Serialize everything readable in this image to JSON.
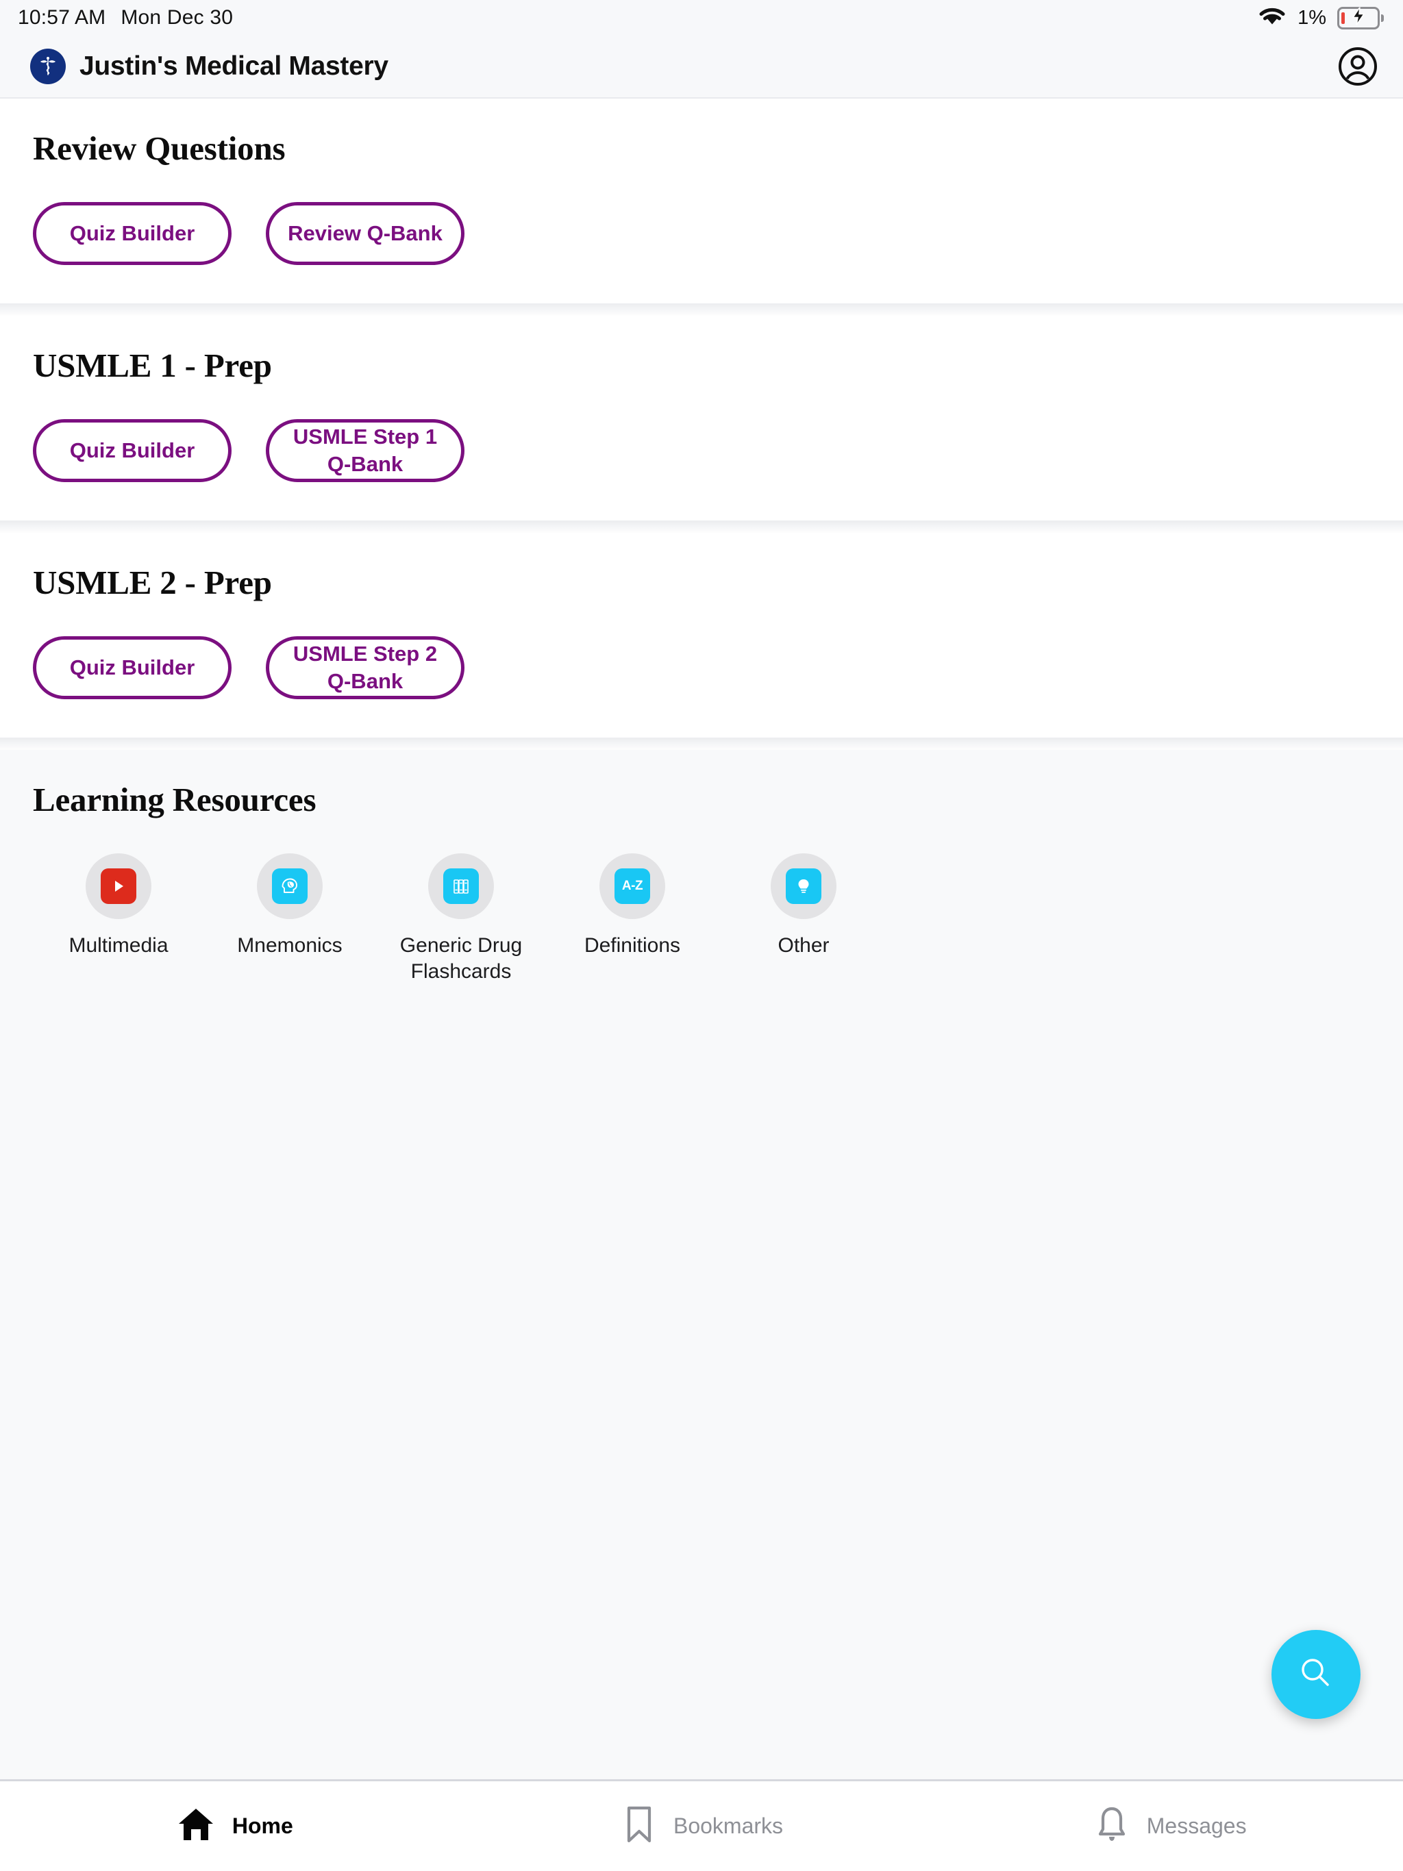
{
  "status_bar": {
    "time": "10:57 AM",
    "date": "Mon Dec 30",
    "wifi_icon": "wifi-icon",
    "battery_percent": "1%",
    "battery_icon": "battery-charging-icon"
  },
  "header": {
    "logo_icon": "caduceus-logo-icon",
    "title": "Justin's Medical Mastery",
    "account_icon": "account-circle-icon"
  },
  "sections": [
    {
      "title": "Review Questions",
      "buttons": [
        {
          "label": "Quiz Builder"
        },
        {
          "label": "Review Q-Bank"
        }
      ]
    },
    {
      "title": "USMLE 1 - Prep",
      "buttons": [
        {
          "label": "Quiz Builder"
        },
        {
          "label": "USMLE Step 1\nQ-Bank"
        }
      ]
    },
    {
      "title": "USMLE 2 - Prep",
      "buttons": [
        {
          "label": "Quiz Builder"
        },
        {
          "label": "USMLE Step 2\nQ-Bank"
        }
      ]
    }
  ],
  "learning_resources": {
    "title": "Learning Resources",
    "items": [
      {
        "label": "Multimedia",
        "icon": "play-video-icon",
        "tile_color": "#dd2b1c"
      },
      {
        "label": "Mnemonics",
        "icon": "brain-head-icon",
        "tile_color": "#19c7f4"
      },
      {
        "label": "Generic Drug\nFlashcards",
        "icon": "books-icon",
        "tile_color": "#19c7f4"
      },
      {
        "label": "Definitions",
        "icon": "a-z-dictionary-icon",
        "tile_color": "#19c7f4"
      },
      {
        "label": "Other",
        "icon": "lightbulb-icon",
        "tile_color": "#19c7f4"
      }
    ]
  },
  "fab": {
    "icon": "search-icon",
    "color": "#22ccf5"
  },
  "tab_bar": {
    "tabs": [
      {
        "label": "Home",
        "icon": "home-icon",
        "active": true
      },
      {
        "label": "Bookmarks",
        "icon": "bookmark-icon",
        "active": false
      },
      {
        "label": "Messages",
        "icon": "bell-icon",
        "active": false
      }
    ]
  },
  "colors": {
    "accent_purple": "#7b0f80",
    "accent_cyan": "#22ccf5",
    "brand_navy": "#12307f",
    "inactive_gray": "#8e9096"
  }
}
